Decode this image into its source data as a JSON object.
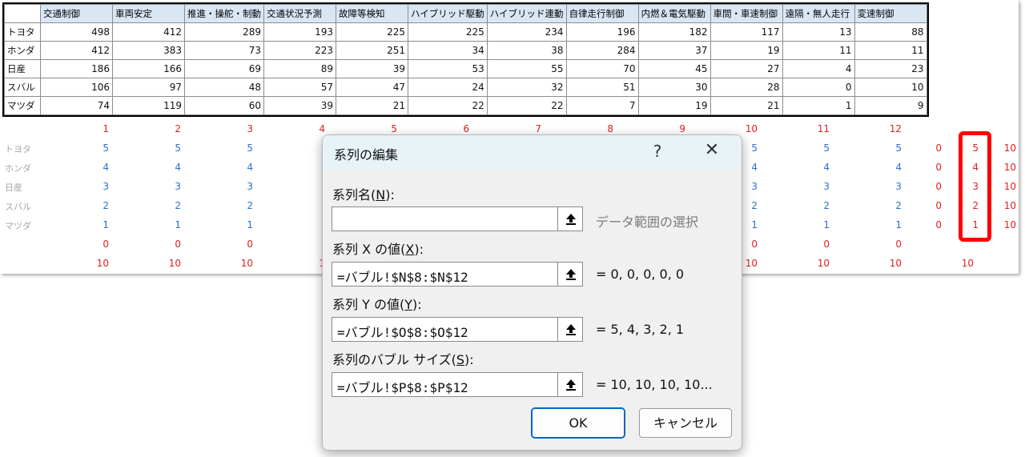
{
  "sheet": {
    "headers": [
      "交通制御",
      "車両安定",
      "推進・操舵・制動",
      "交通状況予測",
      "故障等検知",
      "ハイブリッド駆動",
      "ハイブリッド連動",
      "自律走行制御",
      "内燃＆電気駆動",
      "車間・車速制御",
      "遠隔・無人走行",
      "変速制御"
    ],
    "rows": [
      {
        "label": "トヨタ",
        "values": [
          "498",
          "412",
          "289",
          "193",
          "225",
          "225",
          "234",
          "196",
          "182",
          "117",
          "13",
          "88"
        ]
      },
      {
        "label": "ホンダ",
        "values": [
          "412",
          "383",
          "73",
          "223",
          "251",
          "34",
          "38",
          "284",
          "37",
          "19",
          "11",
          "11"
        ]
      },
      {
        "label": "日産",
        "values": [
          "186",
          "166",
          "69",
          "89",
          "39",
          "53",
          "55",
          "70",
          "45",
          "27",
          "4",
          "23"
        ]
      },
      {
        "label": "スバル",
        "values": [
          "106",
          "97",
          "48",
          "57",
          "47",
          "24",
          "32",
          "51",
          "30",
          "28",
          "0",
          "10"
        ]
      },
      {
        "label": "マツダ",
        "values": [
          "74",
          "119",
          "60",
          "39",
          "21",
          "22",
          "22",
          "7",
          "19",
          "21",
          "1",
          "9"
        ]
      }
    ],
    "index_row": [
      "1",
      "2",
      "3",
      "4",
      "5",
      "6",
      "7",
      "8",
      "9",
      "10",
      "11",
      "12"
    ],
    "rank_rows": [
      {
        "label": "トヨタ",
        "left": [
          "5",
          "5",
          "5"
        ],
        "right": [
          "5",
          "5",
          "5"
        ],
        "n": "0",
        "o": "5",
        "p": "10"
      },
      {
        "label": "ホンダ",
        "left": [
          "4",
          "4",
          "4"
        ],
        "right": [
          "4",
          "4",
          "4"
        ],
        "n": "0",
        "o": "4",
        "p": "10"
      },
      {
        "label": "日産",
        "left": [
          "3",
          "3",
          "3"
        ],
        "right": [
          "3",
          "3",
          "3"
        ],
        "n": "0",
        "o": "3",
        "p": "10"
      },
      {
        "label": "スバル",
        "left": [
          "2",
          "2",
          "2"
        ],
        "right": [
          "2",
          "2",
          "2"
        ],
        "n": "0",
        "o": "2",
        "p": "10"
      },
      {
        "label": "マツダ",
        "left": [
          "1",
          "1",
          "1"
        ],
        "right": [
          "1",
          "1",
          "1"
        ],
        "n": "0",
        "o": "1",
        "p": "10"
      }
    ],
    "zero_row": {
      "left": [
        "0",
        "0",
        "0"
      ],
      "right": [
        "0",
        "0",
        "0"
      ]
    },
    "ten_row": {
      "left": [
        "10",
        "10",
        "10",
        "1"
      ],
      "right": [
        "10",
        "10",
        "10",
        "10"
      ]
    }
  },
  "dialog": {
    "title": "系列の編集",
    "help": "?",
    "close": "✕",
    "series_name": {
      "label_pre": "系列名(",
      "accel": "N",
      "label_post": "):",
      "value": "",
      "preview": "データ範囲の選択"
    },
    "x_values": {
      "label_pre": "系列 X の値(",
      "accel": "X",
      "label_post": "):",
      "value": "=バブル!$N$8:$N$12",
      "preview": "= 0, 0, 0, 0, 0"
    },
    "y_values": {
      "label_pre": "系列 Y の値(",
      "accel": "Y",
      "label_post": "):",
      "value": "=バブル!$O$8:$O$12",
      "preview": "= 5, 4, 3, 2, 1"
    },
    "bubble_size": {
      "label_pre": "系列のバブル サイズ(",
      "accel": "S",
      "label_post": "):",
      "value": "=バブル!$P$8:$P$12",
      "preview": "= 10, 10, 10, 10..."
    },
    "ok_label": "OK",
    "cancel_label": "キャンセル"
  },
  "colors": {
    "highlight": "#ff0000",
    "header_fill": "#d9e7f5",
    "index_red": "#e02020",
    "rank_blue": "#2f6fcf"
  }
}
